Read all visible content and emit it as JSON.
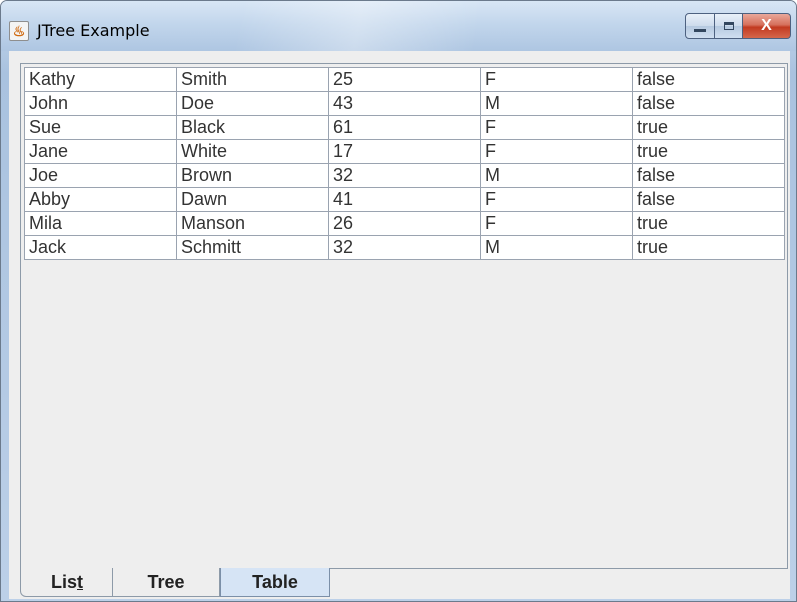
{
  "window": {
    "title": "JTree Example",
    "close_glyph": "X",
    "icon": "java-cup-icon",
    "colors": {
      "frame": "#b7cde6",
      "close": "#c23a21",
      "selected_tab": "#d6e4f5"
    }
  },
  "table": {
    "rows": [
      [
        "Kathy",
        "Smith",
        "25",
        "F",
        "false"
      ],
      [
        "John",
        "Doe",
        "43",
        "M",
        "false"
      ],
      [
        "Sue",
        "Black",
        "61",
        "F",
        "true"
      ],
      [
        "Jane",
        "White",
        "17",
        "F",
        "true"
      ],
      [
        "Joe",
        "Brown",
        "32",
        "M",
        "false"
      ],
      [
        "Abby",
        "Dawn",
        "41",
        "F",
        "false"
      ],
      [
        "Mila",
        "Manson",
        "26",
        "F",
        "true"
      ],
      [
        "Jack",
        "Schmitt",
        "32",
        "M",
        "true"
      ]
    ]
  },
  "tabs": {
    "list": {
      "label_pre": "Lis",
      "label_mnemonic": "t"
    },
    "tree": {
      "label": "Tree"
    },
    "table": {
      "label": "Table"
    },
    "selected": "Table"
  }
}
